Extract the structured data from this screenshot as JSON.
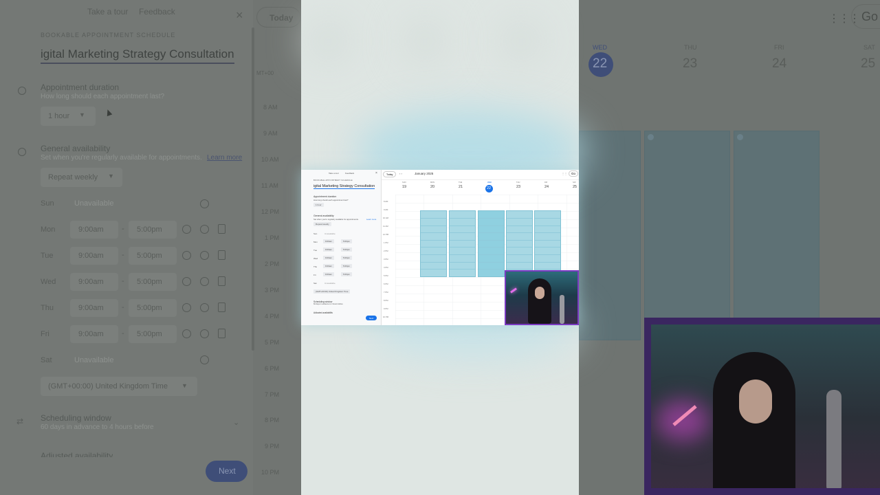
{
  "left_panel": {
    "take_tour": "Take a tour",
    "feedback": "Feedback",
    "close_glyph": "×",
    "section_label": "BOOKABLE APPOINTMENT SCHEDULE",
    "title": "igital Marketing Strategy Consultation",
    "duration": {
      "title": "Appointment duration",
      "subtitle": "How long should each appointment last?",
      "value": "1 hour"
    },
    "availability": {
      "title": "General availability",
      "subtitle": "Set when you're regularly available for appointments.",
      "learn_more": "Learn more",
      "repeat": "Repeat weekly"
    },
    "days": [
      {
        "day": "Sun",
        "unavailable": "Unavailable"
      },
      {
        "day": "Mon",
        "start": "9:00am",
        "end": "5:00pm"
      },
      {
        "day": "Tue",
        "start": "9:00am",
        "end": "5:00pm"
      },
      {
        "day": "Wed",
        "start": "9:00am",
        "end": "5:00pm"
      },
      {
        "day": "Thu",
        "start": "9:00am",
        "end": "5:00pm"
      },
      {
        "day": "Fri",
        "start": "9:00am",
        "end": "5:00pm"
      },
      {
        "day": "Sat",
        "unavailable": "Unavailable"
      }
    ],
    "dash": "-",
    "timezone": "(GMT+00:00) United Kingdom Time",
    "scheduling": {
      "title": "Scheduling window",
      "subtitle": "60 days in advance to 4 hours before"
    },
    "adjusted": "Adjusted availability",
    "next": "Next"
  },
  "calendar_left": {
    "today": "Today",
    "gmt": "MT+00",
    "times": [
      "8 AM",
      "9 AM",
      "10 AM",
      "11 AM",
      "12 PM",
      "1 PM",
      "2 PM",
      "3 PM",
      "4 PM",
      "5 PM",
      "6 PM",
      "7 PM",
      "8 PM",
      "9 PM",
      "10 PM"
    ]
  },
  "calendar_right": {
    "days": [
      {
        "dow": "WED",
        "num": "22"
      },
      {
        "dow": "THU",
        "num": "23"
      },
      {
        "dow": "FRI",
        "num": "24"
      },
      {
        "dow": "SAT",
        "num": "25"
      }
    ],
    "search_partial": "Go"
  },
  "mini": {
    "take_tour": "Take a tour",
    "feedback": "Feedback",
    "close": "×",
    "label": "BOOKABLE APPOINTMENT SCHEDULE",
    "title": "igital Marketing Strategy Consultation",
    "dur_title": "Appointment duration",
    "dur_sub": "How long should each appointment last?",
    "dur_val": "1 hour",
    "avail_title": "General availability",
    "avail_sub": "Set when you're regularly available for appointments.",
    "learn": "Learn more",
    "repeat": "Repeat weekly",
    "rows": [
      [
        "Sun",
        "Unavailable"
      ],
      [
        "Mon",
        "9:00am",
        "5:00pm"
      ],
      [
        "Tue",
        "9:00am",
        "5:00pm"
      ],
      [
        "Wed",
        "9:00am",
        "5:00pm"
      ],
      [
        "Thu",
        "9:00am",
        "5:00pm"
      ],
      [
        "Fri",
        "9:00am",
        "5:00pm"
      ],
      [
        "Sat",
        "Unavailable"
      ]
    ],
    "tz": "(GMT+00:00) United Kingdom Time",
    "sched_title": "Scheduling window",
    "sched_sub": "60 days in advance to 4 hours before",
    "adjusted": "Adjusted availability",
    "next": "Next",
    "today": "Today",
    "month": "January 2025",
    "go": "Go",
    "days": [
      {
        "dow": "SUN",
        "num": "19"
      },
      {
        "dow": "MON",
        "num": "20"
      },
      {
        "dow": "TUE",
        "num": "21"
      },
      {
        "dow": "WED",
        "num": "22"
      },
      {
        "dow": "THU",
        "num": "23"
      },
      {
        "dow": "FRI",
        "num": "24"
      },
      {
        "dow": "SAT",
        "num": "25"
      }
    ],
    "times": [
      "8 AM",
      "9 AM",
      "10 AM",
      "11 AM",
      "12 PM",
      "1 PM",
      "2 PM",
      "3 PM",
      "4 PM",
      "5 PM",
      "6 PM",
      "7 PM",
      "8 PM",
      "9 PM",
      "10 PM"
    ]
  }
}
